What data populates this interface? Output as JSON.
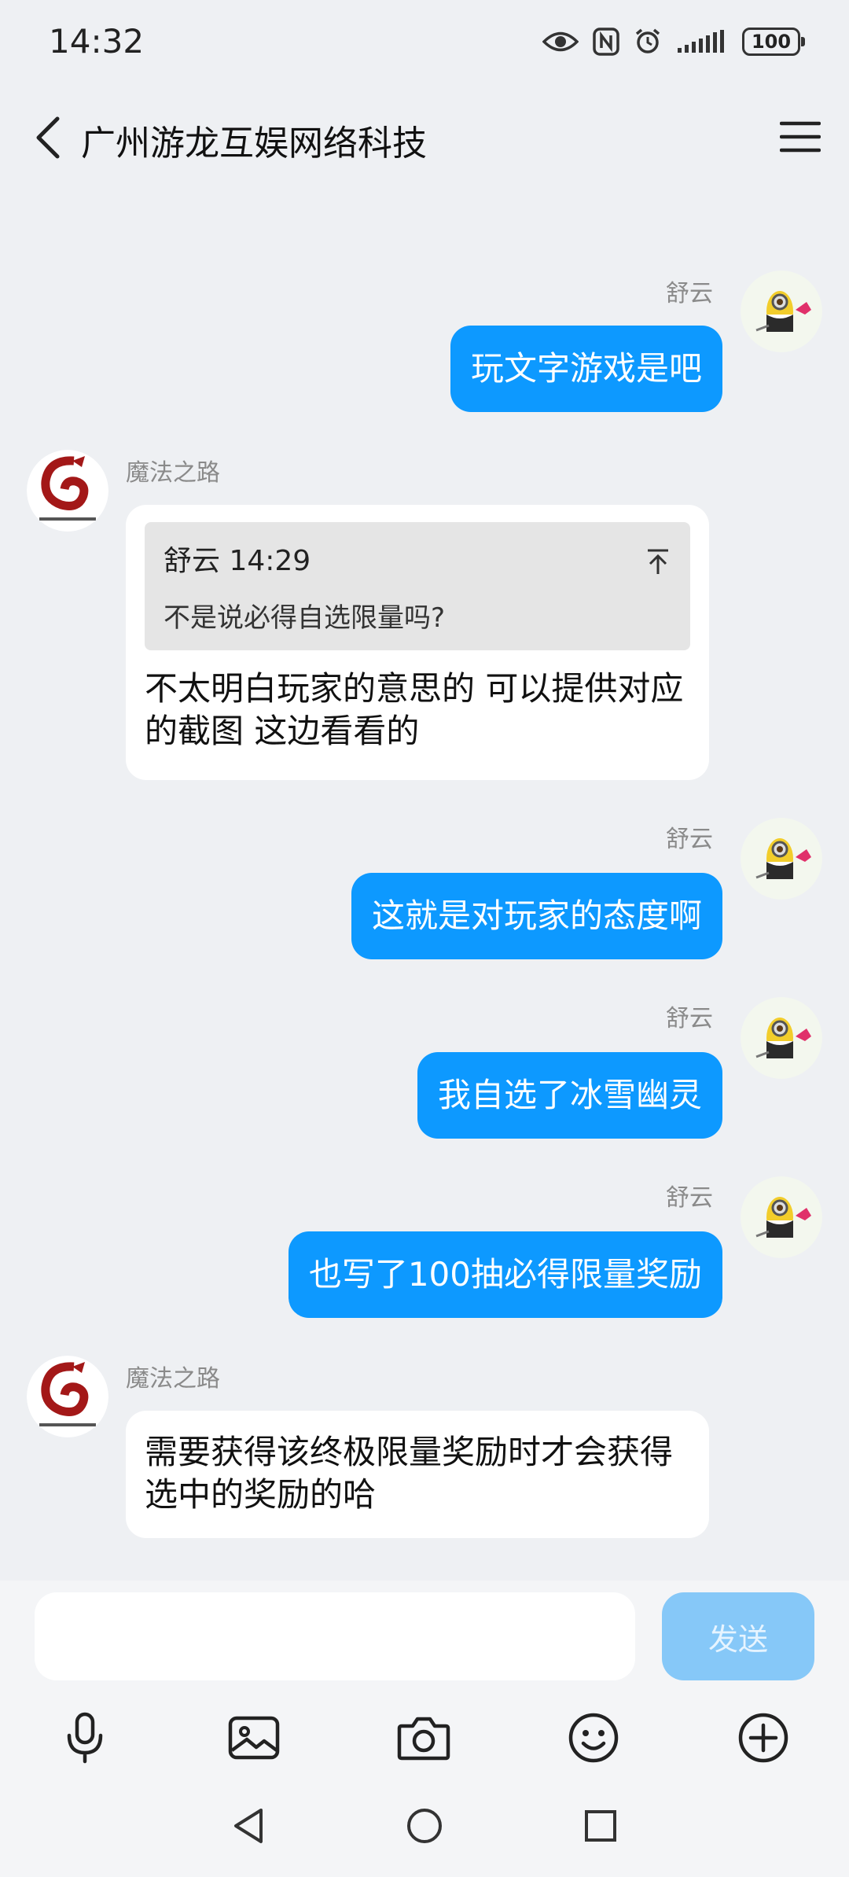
{
  "status_bar": {
    "time": "14:32",
    "icons": [
      "eye-icon",
      "nfc-icon",
      "alarm-icon",
      "signal-icon"
    ],
    "battery": "100"
  },
  "header": {
    "title": "广州游龙互娱网络科技",
    "back_icon": "chevron-left-icon",
    "menu_icon": "menu-icon"
  },
  "messages": [
    {
      "direction": "outgoing",
      "sender": "舒云",
      "text": "玩文字游戏是吧"
    },
    {
      "direction": "incoming",
      "sender": "魔法之路",
      "quote": {
        "author_time": "舒云 14:29",
        "text": "不是说必得自选限量吗?"
      },
      "text": "不太明白玩家的意思的 可以提供对应的截图 这边看看的"
    },
    {
      "direction": "outgoing",
      "sender": "舒云",
      "text": "这就是对玩家的态度啊"
    },
    {
      "direction": "outgoing",
      "sender": "舒云",
      "text": "我自选了冰雪幽灵"
    },
    {
      "direction": "outgoing",
      "sender": "舒云",
      "text": "也写了100抽必得限量奖励"
    },
    {
      "direction": "incoming",
      "sender": "魔法之路",
      "text": "需要获得该终极限量奖励时才会获得选中的奖励的哈"
    }
  ],
  "input": {
    "value": "",
    "placeholder": "",
    "send_label": "发送"
  },
  "toolbar": [
    "microphone-icon",
    "image-icon",
    "camera-icon",
    "emoji-icon",
    "plus-circle-icon"
  ],
  "colors": {
    "outgoing_bubble": "#0d99ff",
    "send_button_disabled": "#86c8f8",
    "background": "#eef0f3"
  }
}
